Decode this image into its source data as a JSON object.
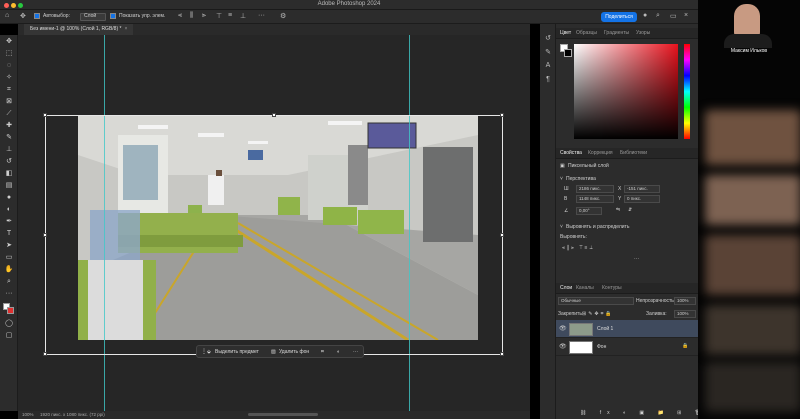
{
  "app": {
    "title": "Adobe Photoshop 2024"
  },
  "options_bar": {
    "autoselect_label": "Автовыбор:",
    "autoselect_value": "Слой",
    "show_controls_label": "Показать упр. элем.",
    "share_label": "Поделиться"
  },
  "document": {
    "tab_label": "Без имени-1 @ 100% (Слой 1, RGB/8) *",
    "close_glyph": "×"
  },
  "status": {
    "zoom": "100%",
    "info": "1920 пикс. x 1080 пикс. (72 ppi)"
  },
  "context_bar": {
    "select_subject_label": "Выделить предмет",
    "remove_bg_label": "Удалить фон",
    "more_glyph": "···"
  },
  "color_panel": {
    "tabs": [
      "Цвет",
      "Образцы",
      "Градиенты",
      "Узоры"
    ],
    "active_tab": "Цвет"
  },
  "properties_panel": {
    "tabs": [
      "Свойства",
      "Коррекция",
      "Библиотеки"
    ],
    "layer_type": "Пиксельный слой",
    "section_transform": "Перспектива",
    "width": "2186 пикс.",
    "height": "1148 пикс.",
    "x_value": "-151 пикс.",
    "y_value": "0 пикс.",
    "angle": "0,00°",
    "section_align": "Выровнять и распределить",
    "align_label": "Выровнять:"
  },
  "layers_panel": {
    "tabs": [
      "Слои",
      "Каналы",
      "Контуры"
    ],
    "blend_mode": "Обычные",
    "opacity_label": "Непрозрачность:",
    "opacity_value": "100%",
    "lock_label": "Закрепить:",
    "fill_label": "Заливка:",
    "fill_value": "100%",
    "layers": [
      {
        "name": "Слой 1",
        "selected": true
      },
      {
        "name": "Фон",
        "selected": false
      }
    ]
  },
  "webcam": {
    "participant_name": "Максим Ильков"
  },
  "colors": {
    "accent": "#1473e6",
    "guide": "#40c8c8",
    "layer_selected": "#3f4a5d",
    "panel_bg": "#2c2c2c",
    "canvas_bg": "#262626"
  },
  "icons": [
    "move-icon",
    "marquee-icon",
    "lasso-icon",
    "crop-icon",
    "brush-icon",
    "eraser-icon",
    "type-icon",
    "hand-icon",
    "zoom-icon",
    "search-icon",
    "gear-icon",
    "eye-icon",
    "lock-icon"
  ]
}
